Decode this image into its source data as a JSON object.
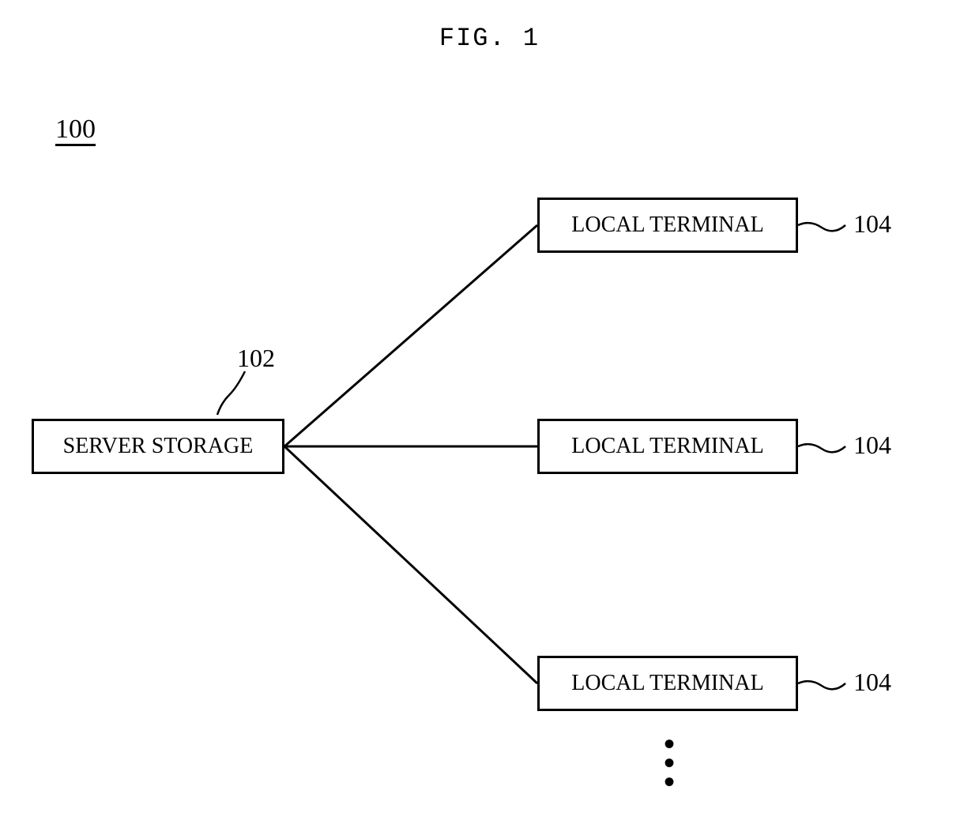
{
  "figure": {
    "title": "FIG. 1",
    "system_number": "100"
  },
  "nodes": {
    "server": {
      "label": "SERVER STORAGE",
      "ref": "102"
    },
    "terminals": [
      {
        "label": "LOCAL TERMINAL",
        "ref": "104"
      },
      {
        "label": "LOCAL TERMINAL",
        "ref": "104"
      },
      {
        "label": "LOCAL TERMINAL",
        "ref": "104"
      }
    ]
  },
  "ellipsis": "⋮"
}
